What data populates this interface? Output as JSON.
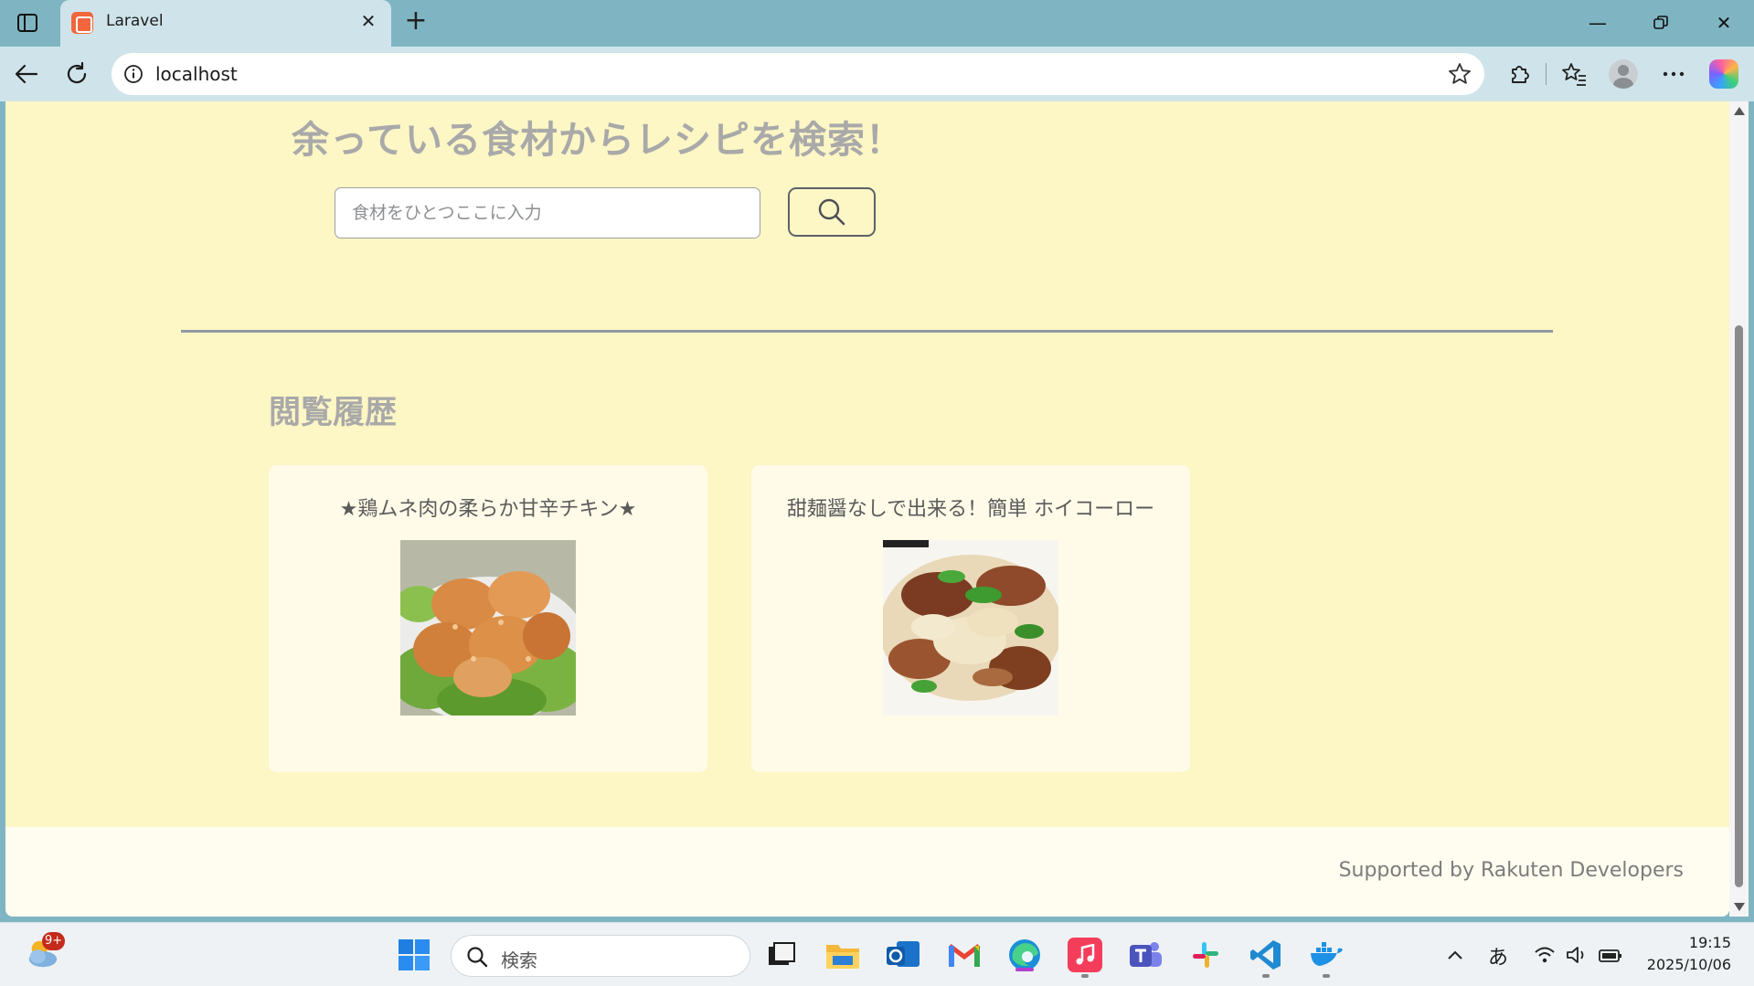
{
  "browser": {
    "tab_title": "Laravel",
    "url": "localhost"
  },
  "page": {
    "heading": "余っている食材からレシピを検索！",
    "search_placeholder": "食材をひとつここに入力",
    "history_title": "閲覧履歴",
    "cards": [
      {
        "title": "★鶏ムネ肉の柔らか甘辛チキン★"
      },
      {
        "title": "甜麺醤なしで出来る！簡単 ホイコーロー"
      }
    ],
    "footer": "Supported by Rakuten Developers"
  },
  "taskbar": {
    "search_label": "検索",
    "weather_badge": "9+",
    "ime": "あ",
    "time": "19:15",
    "date": "2025/10/06"
  },
  "colors": {
    "page_bg": "#fdf6c5",
    "card_bg": "#fffbe8",
    "heading": "#a9a9a9",
    "browser_chrome": "#7fb5c2"
  }
}
